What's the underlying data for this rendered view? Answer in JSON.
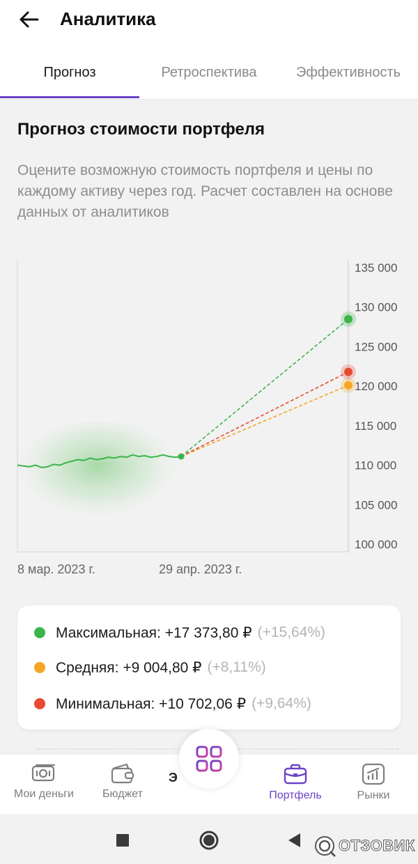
{
  "header": {
    "title": "Аналитика",
    "back_icon": "arrow-left-icon"
  },
  "tabs": [
    {
      "label": "Прогноз",
      "active": true
    },
    {
      "label": "Ретроспектива",
      "active": false
    },
    {
      "label": "Эффективность",
      "active": false
    }
  ],
  "forecast": {
    "title": "Прогноз стоимости портфеля",
    "description": "Оцените возможную стоимость портфеля и цены по каждому активу через год. Расчет составлен на основе данных от аналитиков"
  },
  "chart_data": {
    "type": "line",
    "x_labels": [
      "8 мар. 2023 г.",
      "29 апр. 2023 г."
    ],
    "y_ticks": [
      "135 000",
      "130 000",
      "125 000",
      "120 000",
      "115 000",
      "110 000",
      "105 000",
      "100 000"
    ],
    "ylim": [
      100000,
      135000
    ],
    "history": [
      110000,
      109900,
      109800,
      110000,
      109700,
      109800,
      110100,
      110000,
      110300,
      110500,
      110700,
      110600,
      110900,
      110700,
      110800,
      111000,
      110900,
      111100,
      111000,
      111300,
      111100,
      111200,
      111000,
      111100,
      111300,
      111100,
      111000,
      111100
    ],
    "last_value": 111100,
    "projections": [
      {
        "key": "max",
        "end": 128473,
        "color": "#3cb54a"
      },
      {
        "key": "avg",
        "end": 120105,
        "color": "#f5a623"
      },
      {
        "key": "min",
        "end": 121802,
        "color": "#e84a33"
      }
    ]
  },
  "legend": [
    {
      "label": "Максимальная: +17 373,80 ₽",
      "pct": "(+15,64%)",
      "color": "#3cb54a"
    },
    {
      "label": "Средняя: +9 004,80 ₽",
      "pct": "(+8,11%)",
      "color": "#f5a623"
    },
    {
      "label": "Минимальная: +10 702,06 ₽",
      "pct": "(+9,64%)",
      "color": "#e84a33"
    }
  ],
  "bottom_nav": {
    "items": [
      {
        "label": "Мои деньги",
        "icon": "money-icon",
        "active": false
      },
      {
        "label": "Бюджет",
        "icon": "wallet-icon",
        "active": false
      },
      {
        "label": "Портфель",
        "icon": "briefcase-icon",
        "active": true
      },
      {
        "label": "Рынки",
        "icon": "markets-chart-icon",
        "active": false
      }
    ],
    "center_icon": "grid-apps-icon",
    "center_partial_text": "Э"
  },
  "system_nav": {
    "icons": [
      "recent-apps-icon",
      "home-icon",
      "back-icon"
    ]
  },
  "watermark": {
    "text": "ОТЗОВИК",
    "icon": "otzovik-logo-icon"
  },
  "colors": {
    "accent": "#6b43c9",
    "max": "#3cb54a",
    "avg": "#f5a623",
    "min": "#e84a33"
  }
}
